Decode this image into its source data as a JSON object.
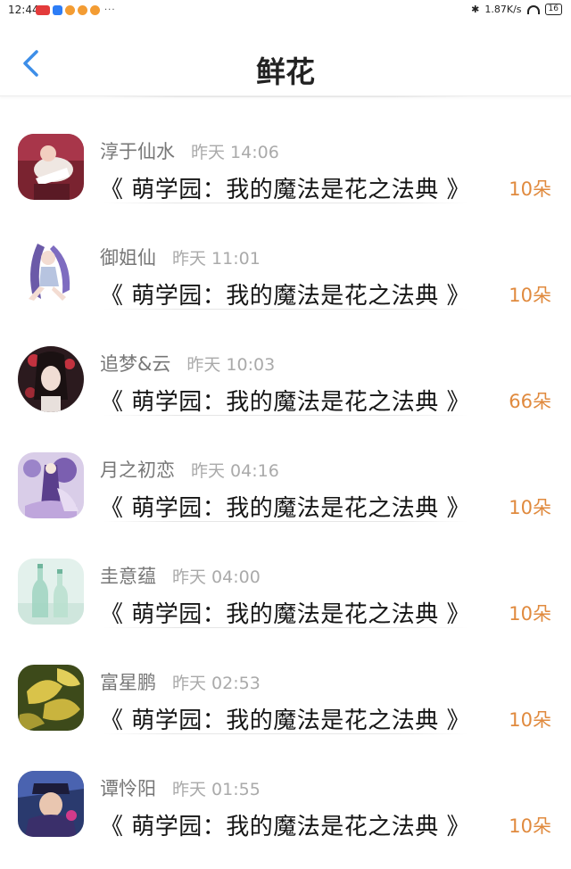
{
  "status_bar": {
    "time": "12:44",
    "app_icons": [
      "red-app-icon",
      "blue-app-icon",
      "weibo-icon",
      "weibo-icon",
      "weibo-icon"
    ],
    "more": "···",
    "bluetooth": "✱",
    "network_speed": "1.87K/s",
    "battery": "16"
  },
  "header": {
    "title": "鲜花",
    "back_icon": "chevron-left-icon"
  },
  "colors": {
    "accent": "#3d8ee8",
    "amount": "#e08a3e",
    "name": "#777777",
    "time": "#aaaaaa"
  },
  "items": [
    {
      "name": "淳于仙水",
      "time": "昨天 14:06",
      "book": "《 萌学园：我的魔法是花之法典 》",
      "amount": "10朵"
    },
    {
      "name": "御姐仙",
      "time": "昨天 11:01",
      "book": "《 萌学园：我的魔法是花之法典 》",
      "amount": "10朵"
    },
    {
      "name": "追梦&云",
      "time": "昨天 10:03",
      "book": "《 萌学园：我的魔法是花之法典 》",
      "amount": "66朵"
    },
    {
      "name": "月之初恋",
      "time": "昨天 04:16",
      "book": "《 萌学园：我的魔法是花之法典 》",
      "amount": "10朵"
    },
    {
      "name": "圭意蕴",
      "time": "昨天 04:00",
      "book": "《 萌学园：我的魔法是花之法典 》",
      "amount": "10朵"
    },
    {
      "name": "富星鹏",
      "time": "昨天 02:53",
      "book": "《 萌学园：我的魔法是花之法典 》",
      "amount": "10朵"
    },
    {
      "name": "谭怜阳",
      "time": "昨天 01:55",
      "book": "《 萌学园：我的魔法是花之法典 》",
      "amount": "10朵"
    }
  ]
}
